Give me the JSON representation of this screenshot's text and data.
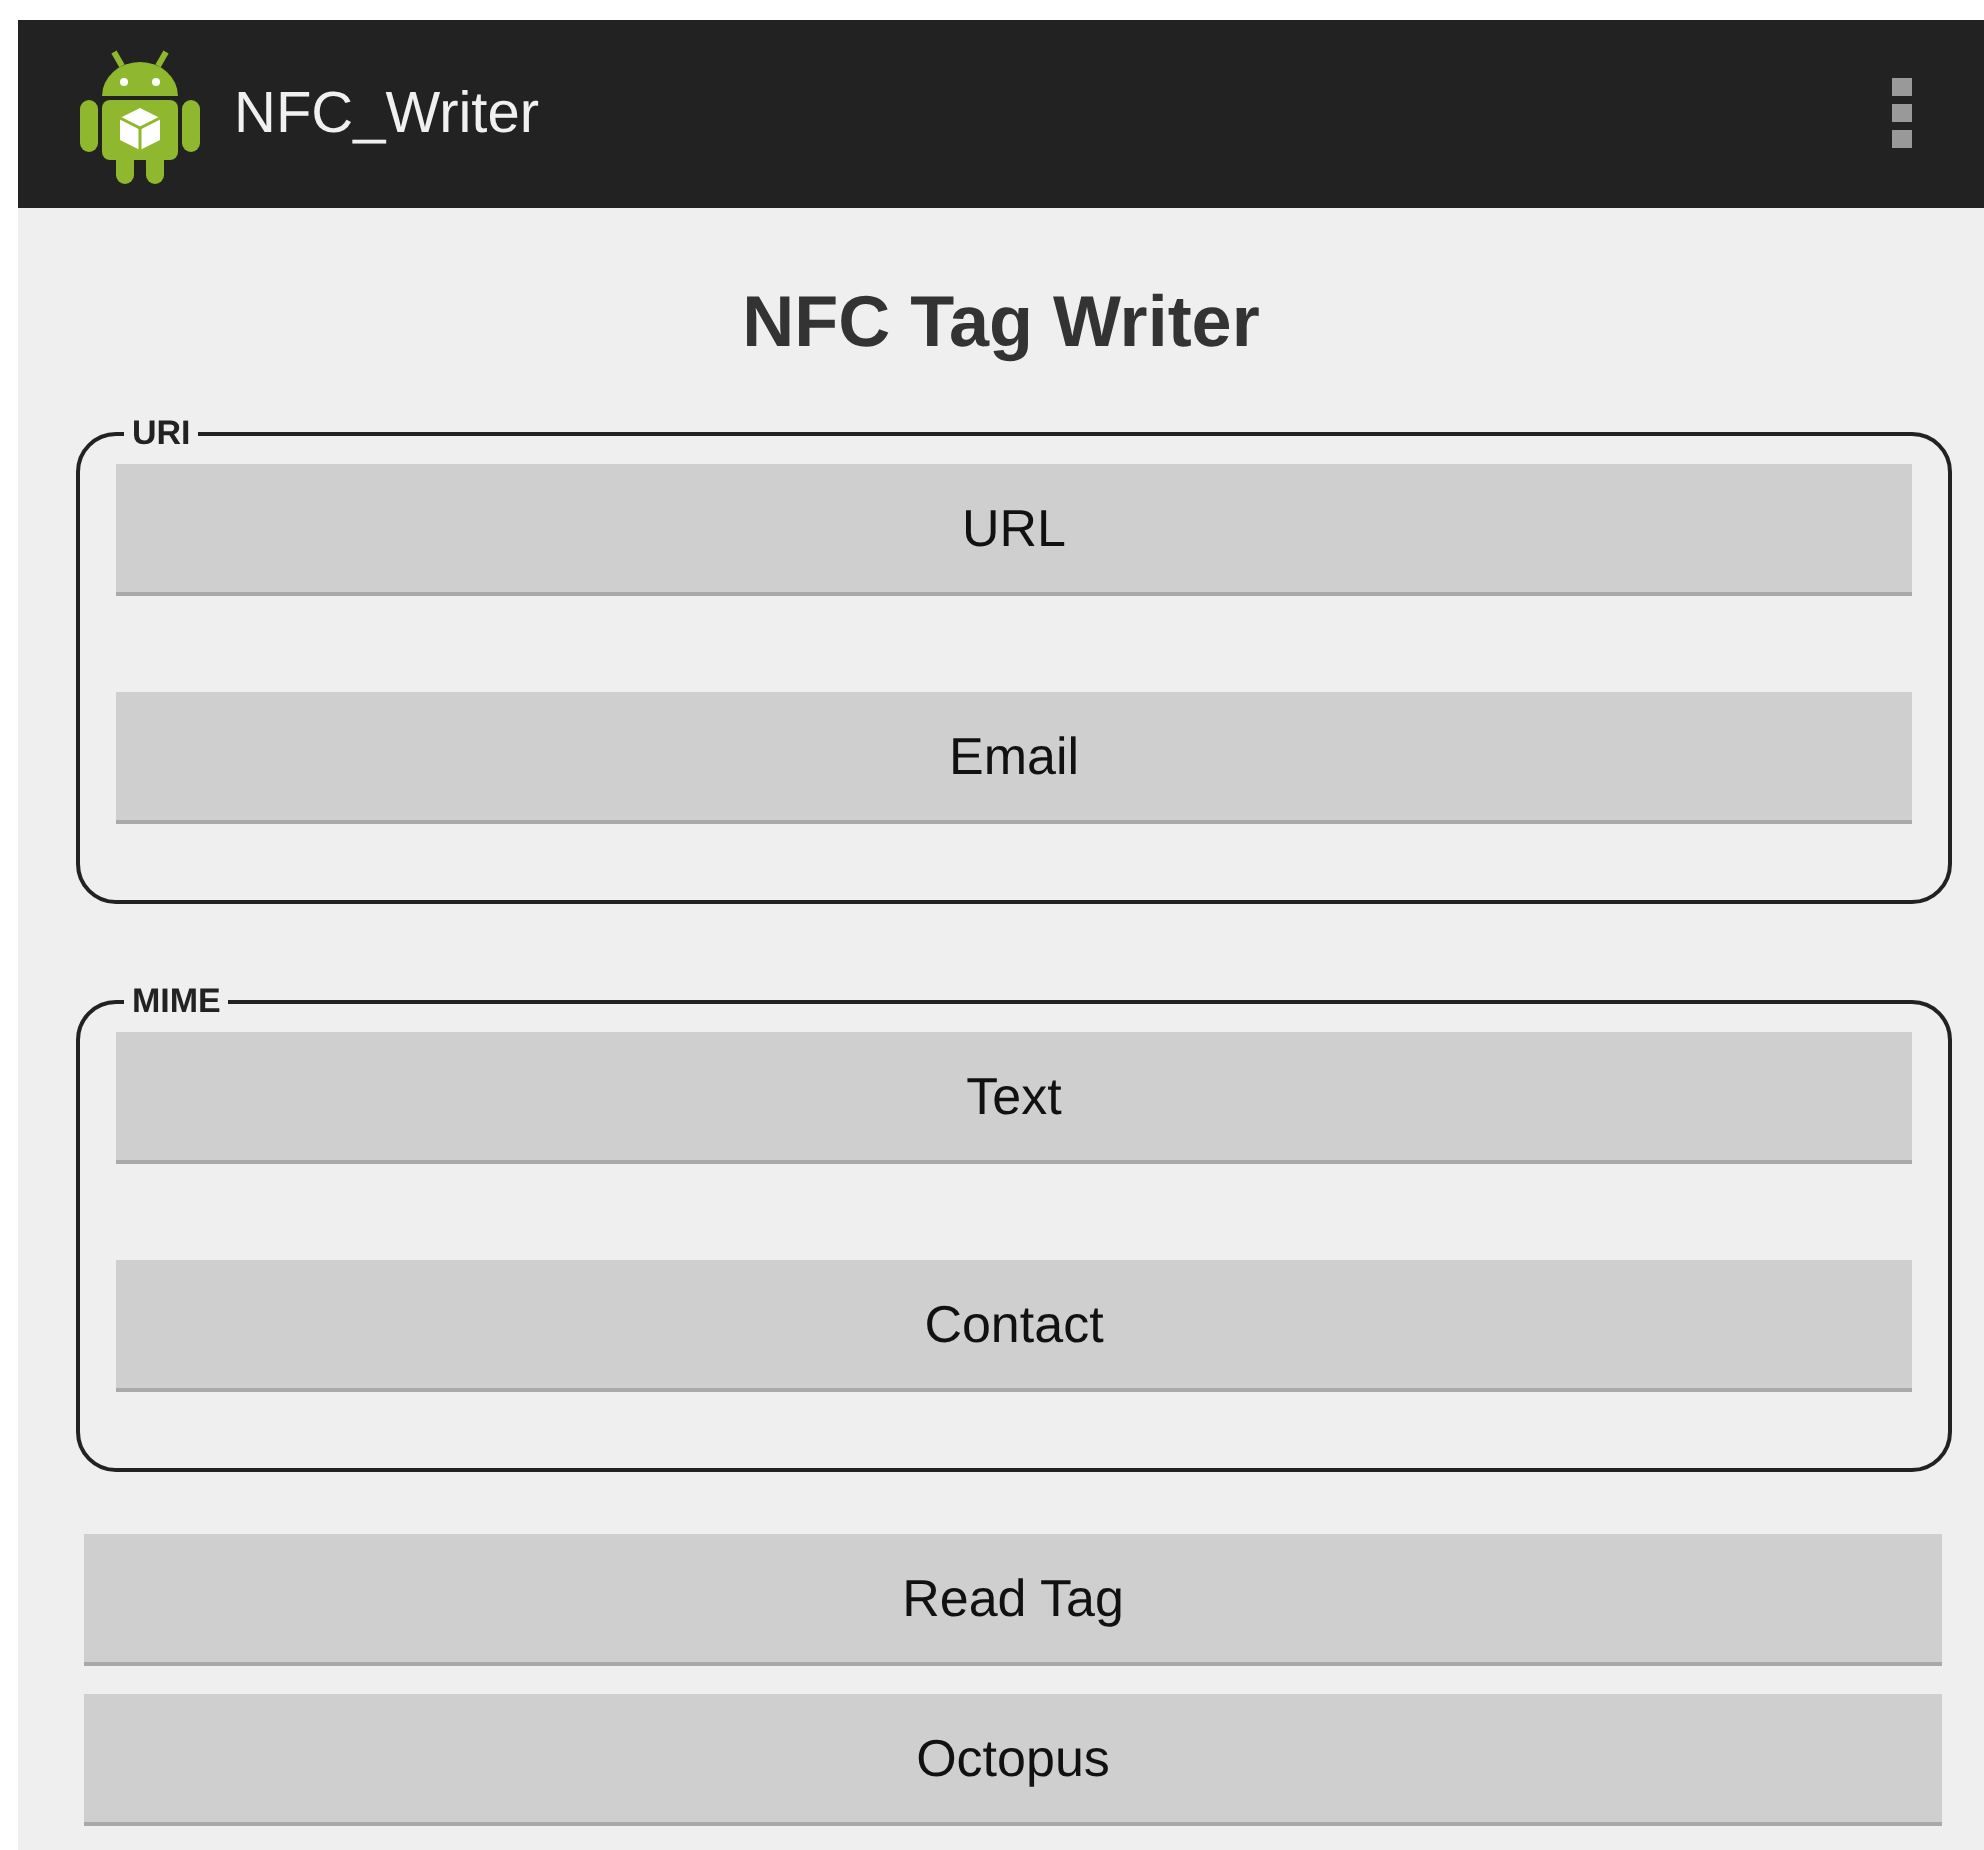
{
  "app_bar": {
    "title": "NFC_Writer"
  },
  "heading": "NFC Tag Writer",
  "groups": [
    {
      "label": "URI",
      "buttons": [
        "URL",
        "Email"
      ]
    },
    {
      "label": "MIME",
      "buttons": [
        "Text",
        "Contact"
      ]
    }
  ],
  "buttons": [
    "Read Tag",
    "Octopus"
  ]
}
